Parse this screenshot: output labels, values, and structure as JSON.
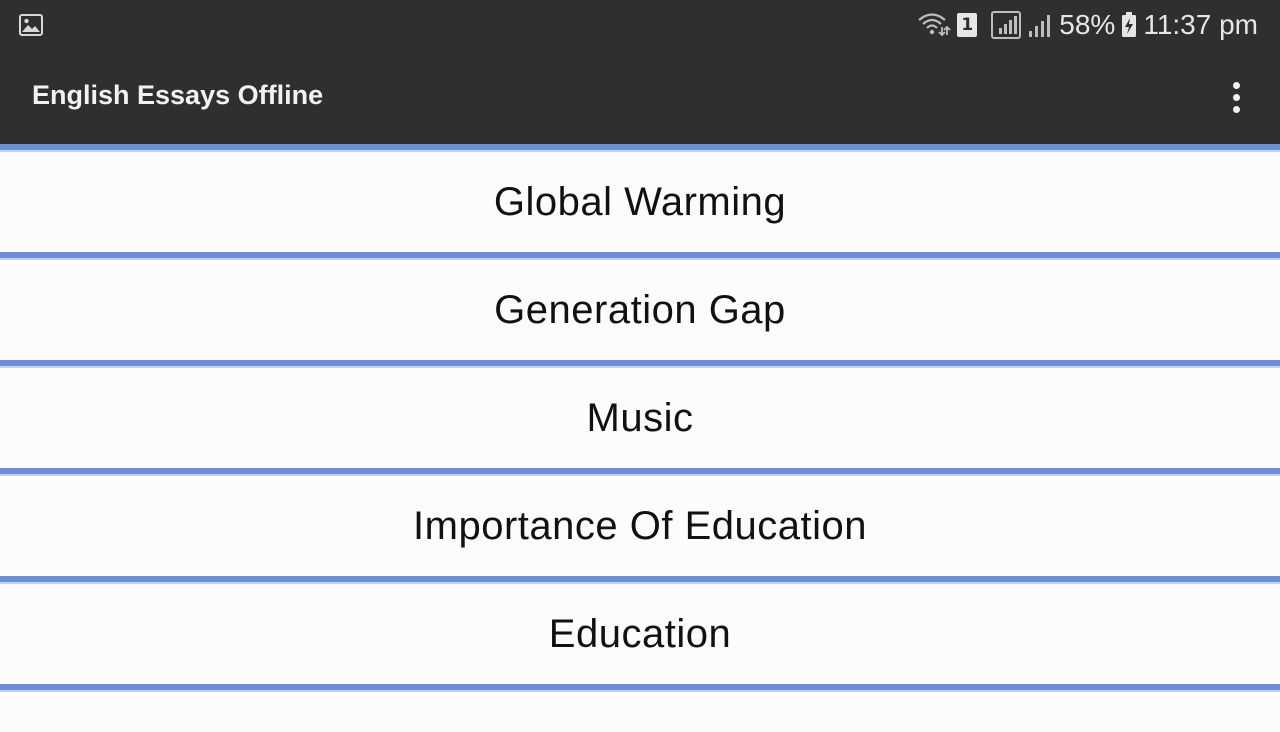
{
  "status_bar": {
    "left_icon": "image-notification-icon",
    "sim_label": "1",
    "battery_percent": "58%",
    "time": "11:37 pm"
  },
  "app_bar": {
    "title": "English Essays Offline",
    "menu_icon": "more-vert-icon"
  },
  "essays": {
    "items": [
      {
        "label": "Global Warming"
      },
      {
        "label": "Generation Gap"
      },
      {
        "label": "Music"
      },
      {
        "label": "Importance Of Education"
      },
      {
        "label": "Education"
      }
    ]
  },
  "colors": {
    "bar_background": "#2e2f2f",
    "divider": "#6a8fd8",
    "list_background": "#fcfcfc"
  }
}
